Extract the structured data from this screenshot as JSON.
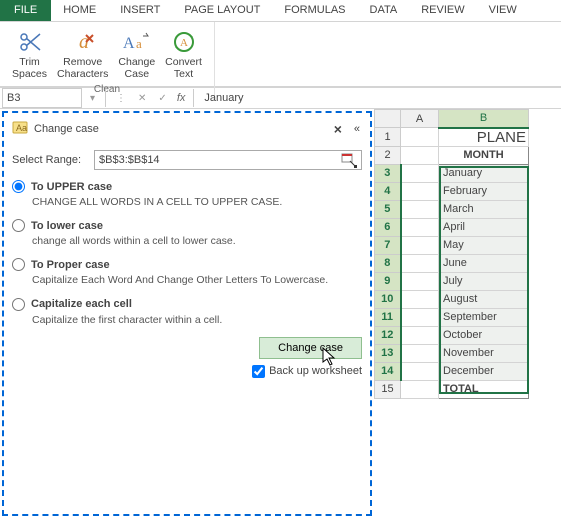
{
  "ribbon": {
    "file": "FILE",
    "tabs": [
      "HOME",
      "INSERT",
      "PAGE LAYOUT",
      "FORMULAS",
      "DATA",
      "REVIEW",
      "VIEW"
    ],
    "group_label": "Clean",
    "buttons": {
      "trim": "Trim\nSpaces",
      "remove": "Remove\nCharacters",
      "change": "Change\nCase",
      "convert": "Convert\nText"
    }
  },
  "formula_bar": {
    "namebox": "B3",
    "value": "January",
    "fx": "fx"
  },
  "pane": {
    "title": "Change case",
    "select_label": "Select Range:",
    "range": "$B$3:$B$14",
    "opts": {
      "upper": {
        "label": "To UPPER case",
        "desc": "CHANGE ALL WORDS IN A CELL TO UPPER CASE."
      },
      "lower": {
        "label": "To lower case",
        "desc": "change all words within a cell to lower case."
      },
      "proper": {
        "label": "To Proper case",
        "desc": "Capitalize Each Word And Change Other Letters To Lowercase."
      },
      "cap": {
        "label": "Capitalize each cell",
        "desc": "Capitalize the first character within a cell."
      }
    },
    "button": "Change case",
    "backup": "Back up worksheet"
  },
  "grid": {
    "cols": [
      "A",
      "B"
    ],
    "plane": "PLANE",
    "month_hdr": "MONTH",
    "rows": [
      "January",
      "February",
      "March",
      "April",
      "May",
      "June",
      "July",
      "August",
      "September",
      "October",
      "November",
      "December"
    ],
    "total": "TOTAL"
  }
}
